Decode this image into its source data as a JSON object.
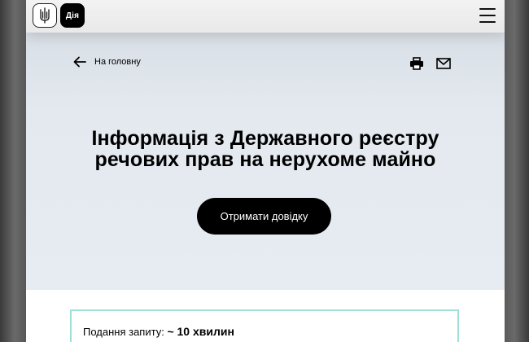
{
  "header": {
    "logo_trident": "trident-icon",
    "logo_diia_text": "Дія",
    "menu_icon": "hamburger-menu-icon"
  },
  "hero": {
    "back_link_label": "На головну",
    "back_icon": "arrow-left-icon",
    "actions": {
      "print_icon": "printer-icon",
      "mail_icon": "mail-icon"
    },
    "title_line1": "Інформація з Державного реєстру",
    "title_line2": "речових прав на нерухоме майно",
    "cta_label": "Отримати довідку"
  },
  "info": {
    "submit_label": "Подання запиту:",
    "submit_value": "~ 10 хвилин"
  },
  "colors": {
    "hero_bg": "#e3e9ef",
    "cta_bg": "#000000",
    "card_border": "#9fe0d6"
  }
}
